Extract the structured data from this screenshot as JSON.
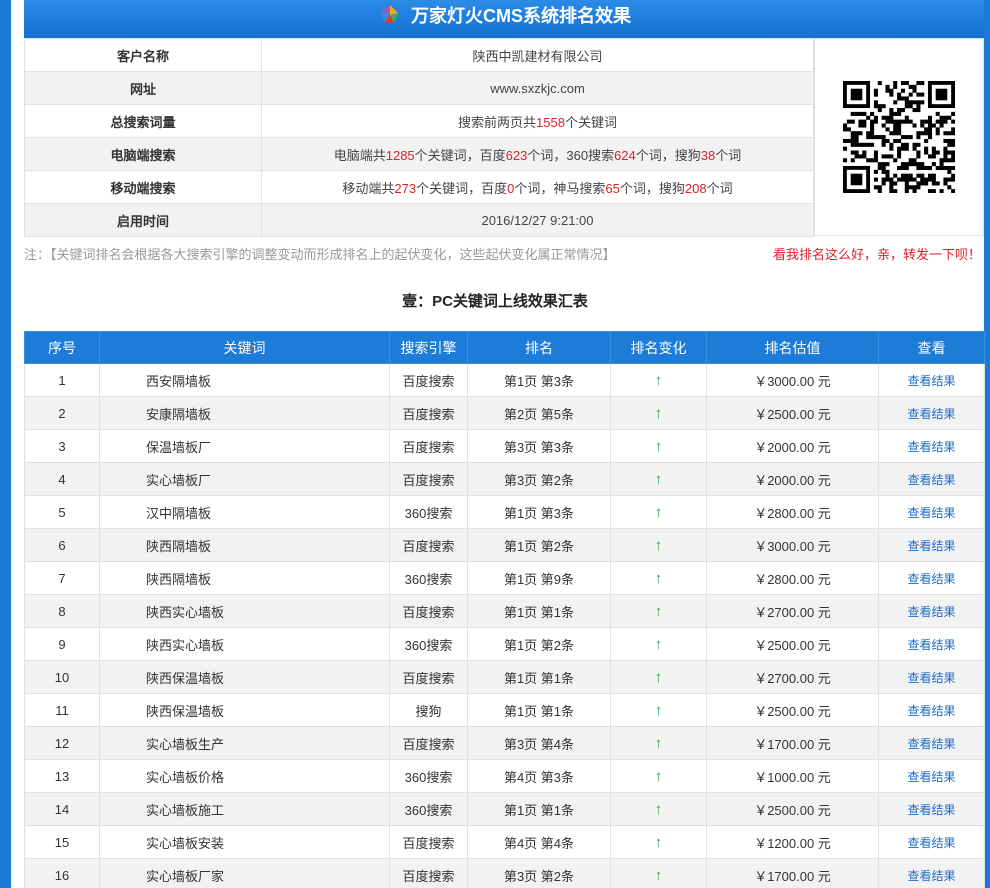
{
  "header": {
    "title": "万家灯火CMS系统排名效果"
  },
  "info": {
    "rows": [
      {
        "label": "客户名称",
        "value": "陕西中凯建材有限公司"
      },
      {
        "label": "网址",
        "value": "www.sxzkjc.com"
      },
      {
        "label": "总搜索词量"
      },
      {
        "label": "电脑端搜索"
      },
      {
        "label": "移动端搜索"
      },
      {
        "label": "启用时间",
        "value": "2016/12/27 9:21:00"
      }
    ],
    "total": {
      "prefix": "搜索前两页共",
      "count": "1558",
      "suffix": "个关键词"
    },
    "pc": {
      "p1": "电脑端共",
      "n1": "1285",
      "p2": "个关键词，百度",
      "n2": "623",
      "p3": "个词，360搜索",
      "n3": "624",
      "p4": "个词，搜狗",
      "n4": "38",
      "p5": "个词"
    },
    "mobile": {
      "p1": "移动端共",
      "n1": "273",
      "p2": "个关键词，百度",
      "n2": "0",
      "p3": "个词，神马搜索",
      "n3": "65",
      "p4": "个词，搜狗",
      "n4": "208",
      "p5": "个词"
    }
  },
  "note": "注：【关键词排名会根据各大搜索引擎的调整变动而形成排名上的起伏变化，这些起伏变化属正常情况】",
  "share_text": "看我排名这么好，亲，转发一下呗！",
  "section_title": "壹：PC关键词上线效果汇表",
  "table": {
    "headers": [
      "序号",
      "关键词",
      "搜索引擎",
      "排名",
      "排名变化",
      "排名估值",
      "查看"
    ],
    "rows": [
      {
        "no": "1",
        "kw": "西安隔墙板",
        "engine": "百度搜索",
        "rank": "第1页 第3条",
        "change": "↑",
        "price": "￥3000.00 元",
        "view": "查看结果"
      },
      {
        "no": "2",
        "kw": "安康隔墙板",
        "engine": "百度搜索",
        "rank": "第2页 第5条",
        "change": "↑",
        "price": "￥2500.00 元",
        "view": "查看结果"
      },
      {
        "no": "3",
        "kw": "保温墙板厂",
        "engine": "百度搜索",
        "rank": "第3页 第3条",
        "change": "↑",
        "price": "￥2000.00 元",
        "view": "查看结果"
      },
      {
        "no": "4",
        "kw": "实心墙板厂",
        "engine": "百度搜索",
        "rank": "第3页 第2条",
        "change": "↑",
        "price": "￥2000.00 元",
        "view": "查看结果"
      },
      {
        "no": "5",
        "kw": "汉中隔墙板",
        "engine": "360搜索",
        "rank": "第1页 第3条",
        "change": "↑",
        "price": "￥2800.00 元",
        "view": "查看结果"
      },
      {
        "no": "6",
        "kw": "陕西隔墙板",
        "engine": "百度搜索",
        "rank": "第1页 第2条",
        "change": "↑",
        "price": "￥3000.00 元",
        "view": "查看结果"
      },
      {
        "no": "7",
        "kw": "陕西隔墙板",
        "engine": "360搜索",
        "rank": "第1页 第9条",
        "change": "↑",
        "price": "￥2800.00 元",
        "view": "查看结果"
      },
      {
        "no": "8",
        "kw": "陕西实心墙板",
        "engine": "百度搜索",
        "rank": "第1页 第1条",
        "change": "↑",
        "price": "￥2700.00 元",
        "view": "查看结果"
      },
      {
        "no": "9",
        "kw": "陕西实心墙板",
        "engine": "360搜索",
        "rank": "第1页 第2条",
        "change": "↑",
        "price": "￥2500.00 元",
        "view": "查看结果"
      },
      {
        "no": "10",
        "kw": "陕西保温墙板",
        "engine": "百度搜索",
        "rank": "第1页 第1条",
        "change": "↑",
        "price": "￥2700.00 元",
        "view": "查看结果"
      },
      {
        "no": "11",
        "kw": "陕西保温墙板",
        "engine": "搜狗",
        "rank": "第1页 第1条",
        "change": "↑",
        "price": "￥2500.00 元",
        "view": "查看结果"
      },
      {
        "no": "12",
        "kw": "实心墙板生产",
        "engine": "百度搜索",
        "rank": "第3页 第4条",
        "change": "↑",
        "price": "￥1700.00 元",
        "view": "查看结果"
      },
      {
        "no": "13",
        "kw": "实心墙板价格",
        "engine": "360搜索",
        "rank": "第4页 第3条",
        "change": "↑",
        "price": "￥1000.00 元",
        "view": "查看结果"
      },
      {
        "no": "14",
        "kw": "实心墙板施工",
        "engine": "360搜索",
        "rank": "第1页 第1条",
        "change": "↑",
        "price": "￥2500.00 元",
        "view": "查看结果"
      },
      {
        "no": "15",
        "kw": "实心墙板安装",
        "engine": "百度搜索",
        "rank": "第4页 第4条",
        "change": "↑",
        "price": "￥1200.00 元",
        "view": "查看结果"
      },
      {
        "no": "16",
        "kw": "实心墙板厂家",
        "engine": "百度搜索",
        "rank": "第3页 第2条",
        "change": "↑",
        "price": "￥1700.00 元",
        "view": "查看结果"
      }
    ]
  },
  "colors": {
    "brand_blue": "#1d7cd8",
    "highlight_red": "#d9232d",
    "up_green": "#2aa44a",
    "link_blue": "#1d6dc9"
  }
}
